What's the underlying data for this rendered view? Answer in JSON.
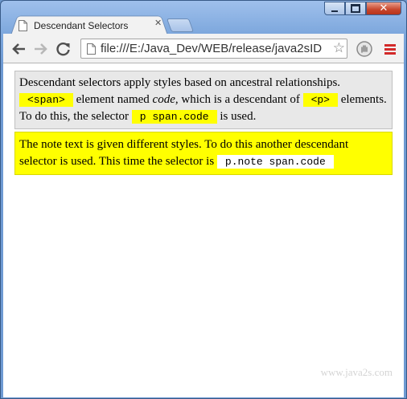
{
  "browser": {
    "tab_title": "Descendant Selectors",
    "url": "file:///E:/Java_Dev/WEB/release/java2sID"
  },
  "content": {
    "p1": {
      "t1": "Descendant selectors apply styles based on ancestral relationships.",
      "code1": "<span>",
      "t2": " element named ",
      "em": "code",
      "t3": ", which is a descendant of ",
      "code2": "<p>",
      "t4": " elements. To do this, the selector ",
      "code3": "p span.code",
      "t5": " is used."
    },
    "p2": {
      "t1": "The note text is given different styles. To do this another descendant selector is used. This time the selector is ",
      "code": "p.note span.code"
    },
    "watermark": "www.java2s.com"
  }
}
